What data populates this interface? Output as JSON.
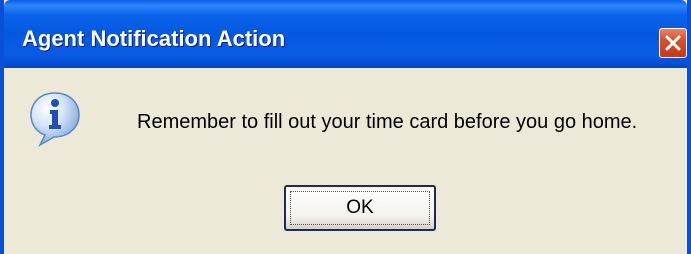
{
  "window": {
    "title": "Agent Notification Action"
  },
  "title_bar": {
    "close_icon": "close-icon"
  },
  "content": {
    "icon": "info-icon",
    "message": "Remember to fill out your time card before you go home."
  },
  "buttons": {
    "ok_label": "OK"
  },
  "colors": {
    "title_bar": "#0A5EE6",
    "dialog_background": "#ECE9D8",
    "close_button": "#D6502E",
    "info_icon": "#2E6FD6"
  }
}
